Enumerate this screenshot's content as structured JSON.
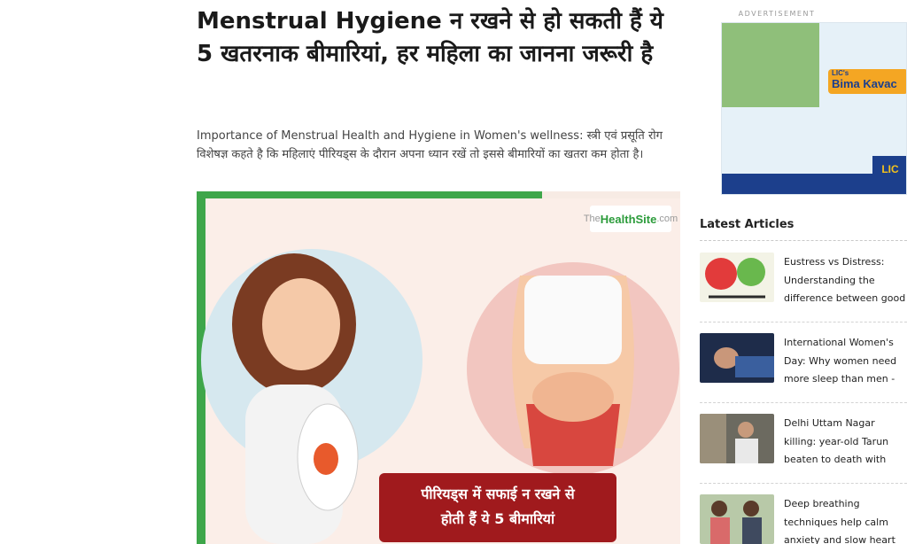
{
  "article": {
    "headline": "Menstrual Hygiene न रखने से हो सकती हैं ये 5 खतरनाक बीमारियां, हर महिला का जानना जरूरी है",
    "summary": "Importance of Menstrual Health and Hygiene in Women's wellness: स्त्री एवं प्रसूति रोग विशेषज्ञ कहते है कि महिलाएं पीरियड्स के दौरान अपना ध्यान रखें तो इससे बीमारियों का खतरा कम होता है।",
    "hero": {
      "logo_the": "The",
      "logo_name": "HealthSite",
      "logo_com": ".com",
      "caption_line1": "पीरियड्स में सफाई न रखने से",
      "caption_line2": "होती हैं ये 5 बीमारियां"
    }
  },
  "sidebar": {
    "ad_label": "ADVERTISEMENT",
    "ad": {
      "title_top": "LIC's",
      "title_main": "Bima Kavac",
      "badge": "LIC"
    },
    "latest_title": "Latest Articles",
    "items": [
      {
        "title": "Eustress vs Distress: Understanding the difference between good stress and"
      },
      {
        "title": "International Women's Day: Why women need more sleep than men - Expert says"
      },
      {
        "title": "Delhi Uttam Nagar killing: year-old Tarun beaten to death with rods and bricks, skull"
      },
      {
        "title": "Deep breathing techniques help calm anxiety and slow heart rate"
      }
    ]
  },
  "colors": {
    "green": "#3ea64a",
    "caption_red": "#a01a1d",
    "hero_bg": "#fbeee8"
  }
}
